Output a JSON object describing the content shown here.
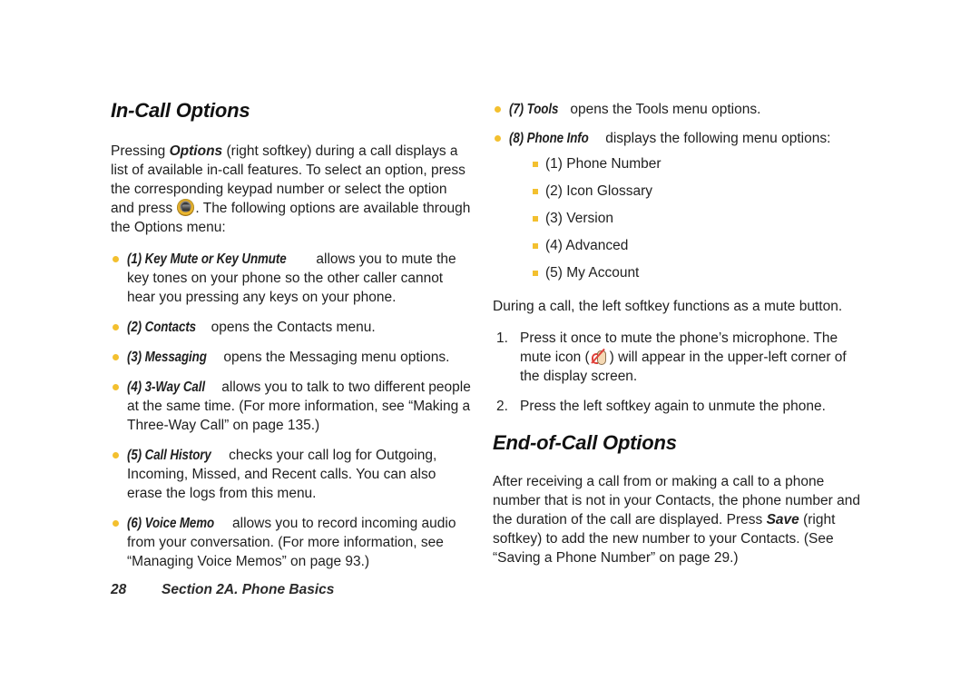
{
  "document": {
    "footer": {
      "page_number": "28",
      "section_label": "Section 2A. Phone Basics"
    }
  },
  "left_column": {
    "heading": "In-Call Options",
    "intro": {
      "part1": "Pressing ",
      "term1": "Options",
      "part2": " (right softkey) during a call displays a list of available in-call features. To select an option, press the corresponding keypad number or select the option and press ",
      "icon": "navigation-key-icon",
      "part3": ". The following options are available through the Options menu:"
    },
    "bullets": [
      {
        "term": "(1) Key Mute or Key Unmute",
        "text": " allows you to mute the key tones on your phone so the other caller cannot hear you pressing any keys on your phone."
      },
      {
        "term": "(2) Contacts",
        "text": " opens the Contacts menu."
      },
      {
        "term": "(3) Messaging",
        "text": " opens the Messaging menu options."
      },
      {
        "term": "(4) 3-Way Call",
        "text": " allows you to talk to two different people at the same time. (For more information, see “Making a Three-Way Call” on page 135.)"
      },
      {
        "term": "(5) Call History",
        "text": " checks your call log for Outgoing, Incoming, Missed, and Recent calls. You can also erase the logs from this menu."
      },
      {
        "term": "(6) Voice Memo",
        "text": " allows you to record incoming audio from your conversation. (For more information, see “Managing Voice Memos” on page 93.)"
      }
    ]
  },
  "right_column": {
    "bullets": [
      {
        "term": "(7) Tools",
        "text": " opens the Tools menu options."
      },
      {
        "term": "(8) Phone Info",
        "text": " displays the following menu options:"
      }
    ],
    "sub_bullets": [
      "(1) Phone Number",
      "(2) Icon Glossary",
      "(3) Version",
      "(4) Advanced",
      "(5) My Account"
    ],
    "mute_intro": "During a call, the left softkey functions as a mute button.",
    "steps": [
      {
        "part1": "Press it once to mute the phone’s microphone. The mute icon (",
        "icon": "mute-icon",
        "part2": ") will appear in the upper-left corner of the display screen."
      },
      {
        "part1": "Press the left softkey again to unmute the phone.",
        "icon": null,
        "part2": ""
      }
    ],
    "heading2": "End-of-Call Options",
    "end_of_call": {
      "part1": "After receiving a call from or making a call to a phone number that is not in your Contacts, the phone number and the duration of the call are displayed. Press ",
      "term1": "Save",
      "part2": " (right softkey) to add the new number to your Contacts. (See “Saving a Phone Number” on page 29.)"
    }
  },
  "colors": {
    "bullet": "#F3C02F",
    "sub_bullet": "#F3C02F",
    "text": "#1f1f1f",
    "slash_red": "#E0413A"
  }
}
